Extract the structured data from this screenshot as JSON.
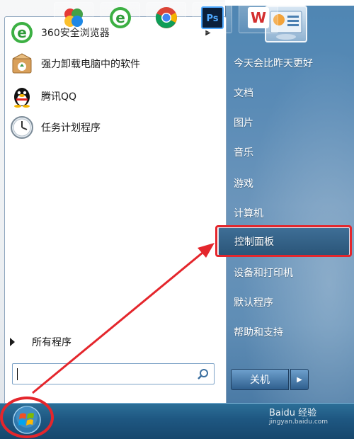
{
  "pinned_programs": [
    {
      "label": "360安全浏览器",
      "icon": "360-browser-icon",
      "has_submenu": true
    },
    {
      "label": "强力卸载电脑中的软件",
      "icon": "uninstaller-box-icon",
      "has_submenu": false
    },
    {
      "label": "腾讯QQ",
      "icon": "qq-penguin-icon",
      "has_submenu": false
    },
    {
      "label": "任务计划程序",
      "icon": "clock-icon",
      "has_submenu": false
    }
  ],
  "all_programs_label": "所有程序",
  "search": {
    "placeholder": "",
    "value": ""
  },
  "right_items": [
    {
      "label": "今天会比昨天更好"
    },
    {
      "label": "文档"
    },
    {
      "label": "图片"
    },
    {
      "label": "音乐"
    },
    {
      "label": "游戏"
    },
    {
      "label": "计算机"
    },
    {
      "label": "控制面板",
      "highlighted": true
    },
    {
      "label": "设备和打印机"
    },
    {
      "label": "默认程序"
    },
    {
      "label": "帮助和支持"
    }
  ],
  "shutdown_label": "关机",
  "taskbar_icons": [
    "start-orb-icon",
    "pinwheel-icon",
    "ie-e-icon",
    "chrome-icon",
    "photoshop-icon",
    "wps-icon"
  ],
  "watermark": {
    "text": "Baidu 经验",
    "sub": "jingyan.baidu.com"
  },
  "colors": {
    "annotation_red": "#e4262c",
    "taskbar_blue": "#1e5781"
  }
}
